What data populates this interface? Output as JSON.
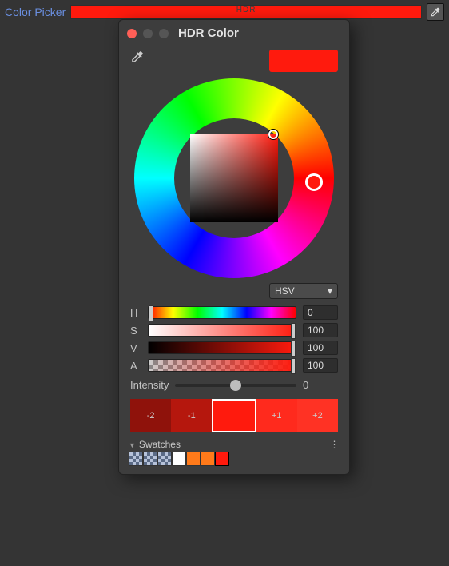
{
  "header": {
    "label": "Color Picker",
    "swatch_text": "HDR",
    "swatch_color": "#ff1a0d"
  },
  "window": {
    "title": "HDR Color",
    "current_color": "#ff1a0d"
  },
  "mode": {
    "selected": "HSV"
  },
  "sliders": {
    "H": {
      "label": "H",
      "value": "0"
    },
    "S": {
      "label": "S",
      "value": "100"
    },
    "V": {
      "label": "V",
      "value": "100"
    },
    "A": {
      "label": "A",
      "value": "100"
    }
  },
  "intensity": {
    "label": "Intensity",
    "value": "0",
    "stops": [
      {
        "label": "-2",
        "color": "#8f120b"
      },
      {
        "label": "-1",
        "color": "#b5170d"
      },
      {
        "label": "",
        "color": "#ff1a0d"
      },
      {
        "label": "+1",
        "color": "#ff2a1d"
      },
      {
        "label": "+2",
        "color": "#ff3224"
      }
    ]
  },
  "swatches": {
    "label": "Swatches",
    "items": [
      {
        "type": "check"
      },
      {
        "type": "check"
      },
      {
        "type": "check"
      },
      {
        "type": "solid",
        "color": "#ffffff"
      },
      {
        "type": "solid",
        "color": "#ff7a1a"
      },
      {
        "type": "solid",
        "color": "#ff7a1a"
      },
      {
        "type": "solid",
        "color": "#ff1a0d"
      }
    ]
  }
}
